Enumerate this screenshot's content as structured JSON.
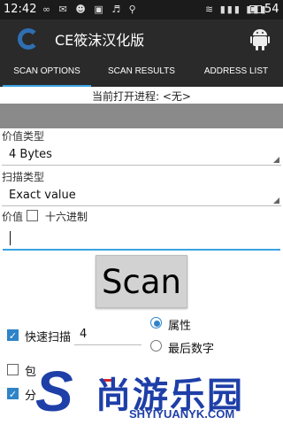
{
  "status_bar": {
    "time": "12:42",
    "icons_left": "∞ ✉ ☻ ▣ ♬ ⚲",
    "icons_right": "≋ ▮▮▮ ▮▮▮",
    "battery": "54"
  },
  "app": {
    "title": "CE筱沫汉化版",
    "logo_icon": "ce-logo-icon",
    "menu_icon": "android-icon"
  },
  "tabs": [
    {
      "label": "SCAN OPTIONS",
      "active": true
    },
    {
      "label": "SCAN RESULTS",
      "active": false
    },
    {
      "label": "ADDRESS LIST",
      "active": false
    }
  ],
  "process_text": "当前打开进程: <无>",
  "value_type": {
    "label": "价值类型",
    "selected": "4 Bytes"
  },
  "scan_type": {
    "label": "扫描类型",
    "selected": "Exact value"
  },
  "value": {
    "label": "价值",
    "hex_label": "十六进制",
    "hex_checked": false,
    "input_value": ""
  },
  "scan_button": "Scan",
  "fast_scan": {
    "label": "快速扫描",
    "checked": true,
    "value": "4"
  },
  "alignment": {
    "option1": "属性",
    "option1_selected": true,
    "option2": "最后数字",
    "option2_selected": false
  },
  "partial_rows": [
    {
      "label": "包",
      "checked": false
    },
    {
      "label": "分",
      "checked": true
    }
  ],
  "watermark": {
    "s": "S",
    "text": "尚游乐园",
    "url": "SHYIYUANYK.COM",
    "color": "#1e3fa8"
  },
  "colors": {
    "accent": "#3aa3e3",
    "checkbox": "#2f84c8",
    "bar_bg": "#2a2a2a"
  }
}
